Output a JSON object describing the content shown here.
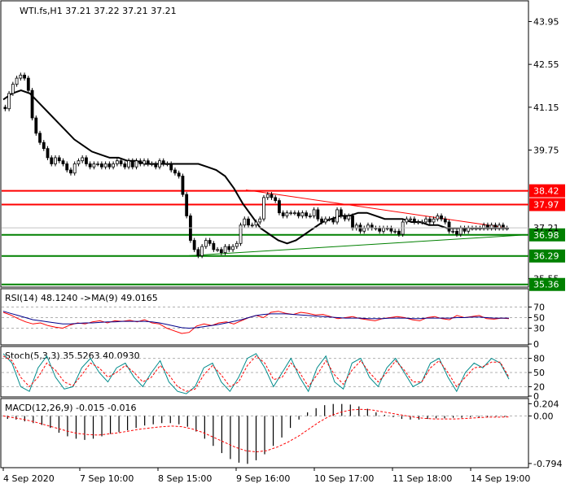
{
  "chart_data": [
    {
      "type": "candlestick",
      "title": "WTI.fs,H1  37.21 37.22 37.21 37.21",
      "symbol": "WTI.fs,H1",
      "ohlc_last": {
        "open": 37.21,
        "high": 37.22,
        "low": 37.21,
        "close": 37.21
      },
      "ylim": [
        35.3,
        44.6
      ],
      "y_ticks": [
        "43.95",
        "42.55",
        "41.15",
        "39.75",
        "35.55"
      ],
      "current_price": "37.21",
      "x_ticks": [
        "4 Sep 2020",
        "7 Sep 10:00",
        "8 Sep 15:00",
        "9 Sep 16:00",
        "10 Sep 17:00",
        "11 Sep 18:00",
        "14 Sep 19:00"
      ],
      "levels": [
        {
          "label": "38.42",
          "value": 38.42,
          "color": "#ff0000"
        },
        {
          "label": "37.97",
          "value": 37.97,
          "color": "#ff0000"
        },
        {
          "label": "36.98",
          "value": 36.98,
          "color": "#008000"
        },
        {
          "label": "36.29",
          "value": 36.29,
          "color": "#008000"
        },
        {
          "label": "35.36",
          "value": 35.36,
          "color": "#008000"
        }
      ],
      "candles_close": [
        41.1,
        41.6,
        41.9,
        42.1,
        42.2,
        42.1,
        41.7,
        40.8,
        40.3,
        40.0,
        39.8,
        39.5,
        39.3,
        39.5,
        39.4,
        39.3,
        39.1,
        39.0,
        39.3,
        39.4,
        39.5,
        39.3,
        39.2,
        39.3,
        39.3,
        39.2,
        39.3,
        39.2,
        39.3,
        39.4,
        39.3,
        39.2,
        39.4,
        39.2,
        39.4,
        39.3,
        39.4,
        39.3,
        39.3,
        39.2,
        39.4,
        39.3,
        39.3,
        39.1,
        39.0,
        38.9,
        38.3,
        37.6,
        36.8,
        36.5,
        36.3,
        36.6,
        36.8,
        36.7,
        36.5,
        36.5,
        36.4,
        36.6,
        36.5,
        36.6,
        36.7,
        37.3,
        37.5,
        37.3,
        37.3,
        37.4,
        37.5,
        38.2,
        38.3,
        38.2,
        38.1,
        37.7,
        37.6,
        37.7,
        37.7,
        37.7,
        37.6,
        37.7,
        37.6,
        37.6,
        37.8,
        37.5,
        37.4,
        37.5,
        37.5,
        37.4,
        37.8,
        37.6,
        37.5,
        37.6,
        37.2,
        37.3,
        37.1,
        37.2,
        37.3,
        37.2,
        37.2,
        37.1,
        37.2,
        37.2,
        37.1,
        37.1,
        37.0,
        37.4,
        37.5,
        37.5,
        37.4,
        37.4,
        37.4,
        37.5,
        37.4,
        37.5,
        37.6,
        37.5,
        37.4,
        37.1,
        37.1,
        37.0,
        37.2,
        37.1,
        37.2,
        37.2,
        37.2,
        37.2,
        37.3,
        37.2,
        37.3,
        37.2,
        37.3,
        37.2,
        37.2
      ],
      "ma_values": [
        41.4,
        41.6,
        41.7,
        41.6,
        41.3,
        41.0,
        40.7,
        40.4,
        40.1,
        39.9,
        39.7,
        39.6,
        39.5,
        39.5,
        39.4,
        39.4,
        39.3,
        39.3,
        39.3,
        39.3,
        39.3,
        39.3,
        39.3,
        39.2,
        39.1,
        38.9,
        38.5,
        38.0,
        37.6,
        37.2,
        37.0,
        36.8,
        36.7,
        36.8,
        37.0,
        37.2,
        37.4,
        37.5,
        37.6,
        37.6,
        37.7,
        37.7,
        37.6,
        37.5,
        37.5,
        37.5,
        37.4,
        37.4,
        37.3,
        37.3,
        37.2,
        37.2,
        37.2,
        37.2,
        37.2,
        37.2,
        37.2,
        37.2
      ],
      "trend_down": {
        "from": 38.45,
        "to": 37.2
      },
      "trend_up": {
        "from": 36.3,
        "to": 36.98
      }
    },
    {
      "type": "line",
      "title": "RSI(14) 48.1240  ->MA(9) 49.0165",
      "y_ticks": [
        "70",
        "50",
        "30",
        "0"
      ],
      "ylim": [
        0,
        100
      ],
      "series": [
        {
          "color": "#ff0000",
          "values": [
            60,
            55,
            48,
            42,
            38,
            40,
            35,
            32,
            30,
            36,
            40,
            38,
            42,
            44,
            40,
            44,
            43,
            45,
            42,
            46,
            40,
            38,
            30,
            25,
            20,
            22,
            34,
            38,
            35,
            40,
            42,
            38,
            44,
            50,
            54,
            50,
            60,
            62,
            58,
            56,
            60,
            58,
            55,
            56,
            52,
            48,
            50,
            52,
            48,
            46,
            44,
            48,
            50,
            52,
            50,
            46,
            44,
            50,
            52,
            48,
            46,
            54,
            50,
            52,
            54,
            48,
            47,
            49,
            48
          ]
        },
        {
          "color": "#00008b",
          "values": [
            62,
            58,
            54,
            50,
            46,
            44,
            42,
            40,
            38,
            38,
            39,
            40,
            40,
            41,
            42,
            42,
            43,
            43,
            43,
            43,
            42,
            40,
            37,
            34,
            31,
            30,
            31,
            33,
            35,
            37,
            40,
            43,
            46,
            50,
            54,
            56,
            57,
            57,
            57,
            56,
            55,
            54,
            53,
            52,
            51,
            50,
            49,
            49,
            49,
            48,
            48,
            48,
            49,
            49,
            49,
            48,
            48,
            49,
            49,
            49,
            49,
            50,
            50,
            51,
            51,
            50,
            49,
            49,
            49
          ]
        }
      ]
    },
    {
      "type": "line",
      "title": "Stoch(5,3,3) 35.5263 40.0930",
      "y_ticks": [
        "80",
        "50",
        "20",
        "0"
      ],
      "ylim": [
        0,
        100
      ],
      "series": [
        {
          "color": "#008b8b",
          "values": [
            90,
            70,
            20,
            10,
            60,
            85,
            40,
            15,
            20,
            60,
            80,
            50,
            30,
            60,
            70,
            40,
            20,
            50,
            75,
            30,
            10,
            5,
            20,
            60,
            70,
            30,
            10,
            40,
            80,
            90,
            60,
            20,
            50,
            80,
            40,
            10,
            60,
            85,
            30,
            15,
            70,
            80,
            40,
            20,
            60,
            80,
            50,
            20,
            30,
            70,
            80,
            40,
            10,
            50,
            70,
            60,
            80,
            70,
            36
          ]
        },
        {
          "color": "#ff0000",
          "values": [
            85,
            75,
            40,
            20,
            40,
            70,
            55,
            30,
            22,
            45,
            70,
            60,
            40,
            50,
            65,
            50,
            30,
            40,
            65,
            45,
            20,
            10,
            15,
            45,
            65,
            45,
            20,
            30,
            65,
            85,
            70,
            35,
            40,
            70,
            50,
            20,
            45,
            75,
            45,
            25,
            55,
            75,
            50,
            30,
            50,
            75,
            55,
            30,
            30,
            60,
            75,
            50,
            20,
            40,
            60,
            62,
            72,
            72,
            40
          ]
        }
      ]
    },
    {
      "type": "bar",
      "title": "MACD(12,26,9) -0.015 -0.016",
      "y_ticks": [
        "0.204",
        "0.00",
        "-0.794"
      ],
      "ylim": [
        -0.85,
        0.25
      ],
      "values": [
        -0.05,
        -0.06,
        -0.09,
        -0.12,
        -0.15,
        -0.2,
        -0.28,
        -0.34,
        -0.38,
        -0.4,
        -0.38,
        -0.34,
        -0.3,
        -0.27,
        -0.24,
        -0.2,
        -0.16,
        -0.14,
        -0.12,
        -0.12,
        -0.14,
        -0.18,
        -0.26,
        -0.38,
        -0.5,
        -0.62,
        -0.72,
        -0.78,
        -0.8,
        -0.74,
        -0.64,
        -0.5,
        -0.36,
        -0.2,
        -0.06,
        0.06,
        0.13,
        0.18,
        0.2,
        0.2,
        0.19,
        0.16,
        0.12,
        0.06,
        0.02,
        -0.02,
        -0.05,
        -0.06,
        -0.06,
        -0.05,
        -0.04,
        -0.04,
        -0.03,
        -0.03,
        -0.02,
        -0.02,
        -0.02,
        -0.01,
        -0.015
      ],
      "signal": [
        0.0,
        -0.03,
        -0.06,
        -0.1,
        -0.15,
        -0.2,
        -0.25,
        -0.29,
        -0.31,
        -0.32,
        -0.3,
        -0.28,
        -0.25,
        -0.22,
        -0.2,
        -0.18,
        -0.17,
        -0.18,
        -0.22,
        -0.28,
        -0.36,
        -0.44,
        -0.52,
        -0.58,
        -0.6,
        -0.58,
        -0.52,
        -0.44,
        -0.34,
        -0.22,
        -0.1,
        0.0,
        0.06,
        0.1,
        0.11,
        0.1,
        0.07,
        0.04,
        0.01,
        -0.02,
        -0.04,
        -0.05,
        -0.05,
        -0.05,
        -0.04,
        -0.03,
        -0.02,
        -0.02,
        -0.016
      ]
    }
  ]
}
